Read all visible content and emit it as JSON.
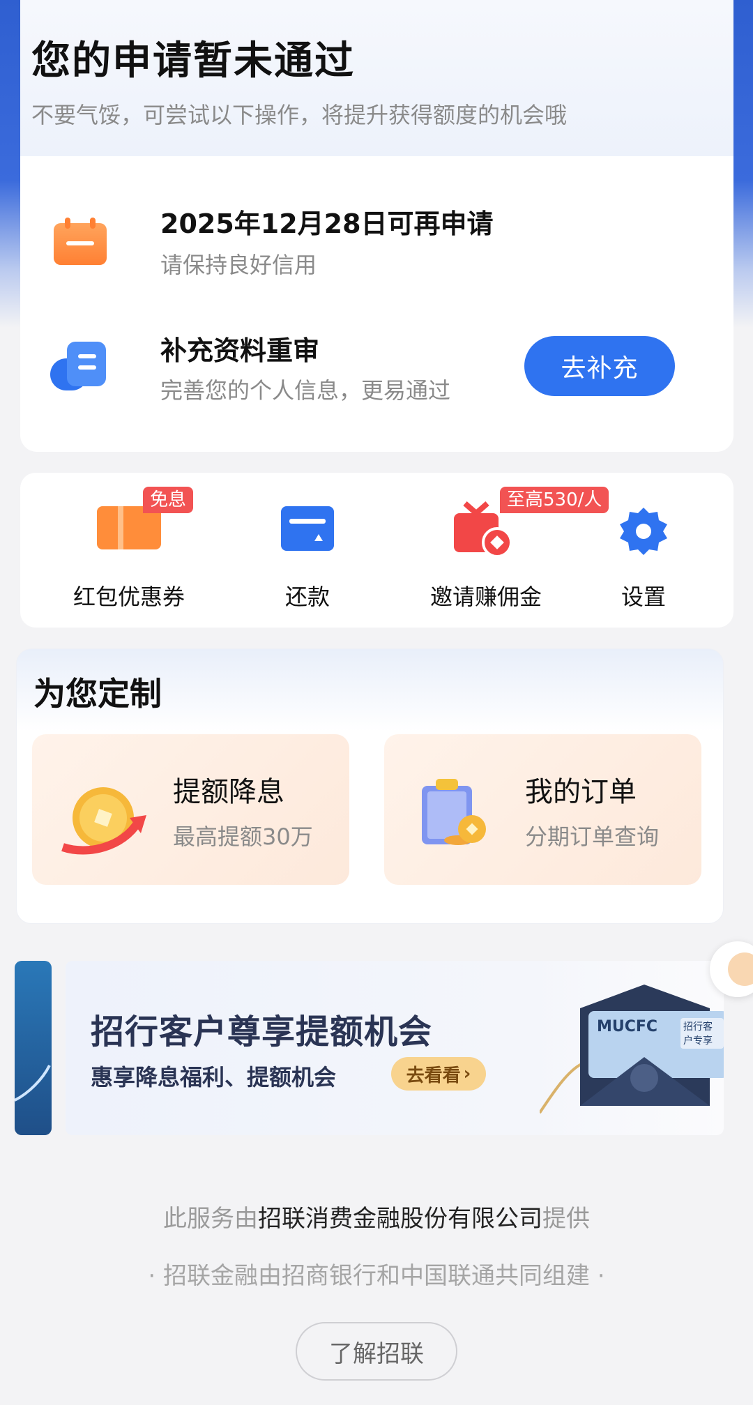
{
  "status": {
    "title": "您的申请暂未通过",
    "subtitle": "不要气馁，可尝试以下操作，将提升获得额度的机会哦",
    "reapply": {
      "title": "2025年12月28日可再申请",
      "subtitle": "请保持良好信用",
      "icon": "calendar-icon"
    },
    "supplement": {
      "title": "补充资料重审",
      "subtitle": "完善您的个人信息，更易通过",
      "button": "去补充",
      "icon": "document-icon"
    }
  },
  "quick_actions": [
    {
      "label": "红包优惠券",
      "badge": "免息",
      "icon": "coupon-icon"
    },
    {
      "label": "还款",
      "badge": "",
      "icon": "repay-icon"
    },
    {
      "label": "邀请赚佣金",
      "badge": "至高530/人",
      "icon": "gift-icon"
    },
    {
      "label": "设置",
      "badge": "",
      "icon": "gear-icon"
    }
  ],
  "custom": {
    "title": "为您定制",
    "tiles": [
      {
        "title": "提额降息",
        "subtitle": "最高提额30万",
        "icon": "coin-arrow-icon"
      },
      {
        "title": "我的订单",
        "subtitle": "分期订单查询",
        "icon": "clipboard-coin-icon"
      }
    ]
  },
  "banner": {
    "title": "招行客户尊享提额机会",
    "subtitle": "惠享降息福利、提额机会",
    "button": "去看看",
    "card_brand": "MUCFC",
    "card_tag": "招行客户专享"
  },
  "footer": {
    "prefix": "此服务由",
    "company": "招联消费金融股份有限公司",
    "suffix": "提供",
    "line2": "· 招联金融由招商银行和中国联通共同组建 ·",
    "learn_button": "了解招联"
  },
  "colors": {
    "primary": "#2f73f0",
    "badge": "#f25353",
    "accent_orange": "#ff8033"
  }
}
